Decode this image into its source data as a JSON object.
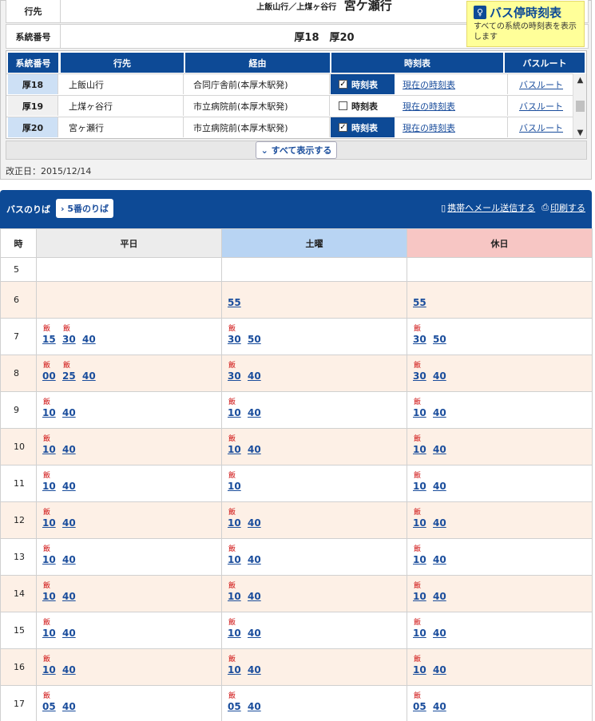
{
  "info": {
    "dest_label": "行先",
    "dest_small": "上飯山行／上煤ヶ谷行",
    "dest_big": "宮ケ瀬行",
    "num_label": "系統番号",
    "num_value": "厚18　厚20"
  },
  "stop_timetable": {
    "icon": "bus-stop-icon",
    "title": "バス停時刻表",
    "desc": "すべての系統の時刻表を表示します"
  },
  "route_table": {
    "headers": [
      "系統番号",
      "行先",
      "経由",
      "時刻表",
      "バスルート"
    ],
    "rows": [
      {
        "code": "厚18",
        "dest": "上飯山行",
        "via": "合同庁舎前(本厚木駅発)",
        "chk_label": "時刻表",
        "checked": "✓",
        "current": "現在の時刻表",
        "route": "バスルート"
      },
      {
        "code": "厚19",
        "dest": "上煤ヶ谷行",
        "via": "市立病院前(本厚木駅発)",
        "chk_label": "時刻表",
        "checked": "",
        "current": "現在の時刻表",
        "route": "バスルート"
      },
      {
        "code": "厚20",
        "dest": "宮ヶ瀬行",
        "via": "市立病院前(本厚木駅発)",
        "chk_label": "時刻表",
        "checked": "✓",
        "current": "現在の時刻表",
        "route": "バスルート"
      }
    ],
    "scroll_up": "▲",
    "scroll_down": "▼"
  },
  "show_all": "⌄ すべて表示する",
  "revised": "改正日：2015/12/14",
  "timetable": {
    "label": "バスのりば",
    "platform": "› 5番のりば",
    "mail_link": "携帯へメール送信する",
    "print_link": "印刷する",
    "col_hour": "時",
    "col_weekday": "平日",
    "col_saturday": "土曜",
    "col_holiday": "休日",
    "rows": [
      {
        "hour": "5",
        "weekday": [],
        "saturday": [],
        "holiday": []
      },
      {
        "hour": "6",
        "weekday": [],
        "saturday": [
          {
            "via": "",
            "min": "55"
          }
        ],
        "holiday": [
          {
            "via": "",
            "min": "55"
          }
        ]
      },
      {
        "hour": "7",
        "weekday": [
          {
            "via": "飯",
            "min": "15"
          },
          {
            "via": "飯",
            "min": "30"
          },
          {
            "via": "",
            "min": "40"
          }
        ],
        "saturday": [
          {
            "via": "飯",
            "min": "30"
          },
          {
            "via": "",
            "min": "50"
          }
        ],
        "holiday": [
          {
            "via": "飯",
            "min": "30"
          },
          {
            "via": "",
            "min": "50"
          }
        ]
      },
      {
        "hour": "8",
        "weekday": [
          {
            "via": "飯",
            "min": "00"
          },
          {
            "via": "飯",
            "min": "25"
          },
          {
            "via": "",
            "min": "40"
          }
        ],
        "saturday": [
          {
            "via": "飯",
            "min": "30"
          },
          {
            "via": "",
            "min": "40"
          }
        ],
        "holiday": [
          {
            "via": "飯",
            "min": "30"
          },
          {
            "via": "",
            "min": "40"
          }
        ]
      },
      {
        "hour": "9",
        "weekday": [
          {
            "via": "飯",
            "min": "10"
          },
          {
            "via": "",
            "min": "40"
          }
        ],
        "saturday": [
          {
            "via": "飯",
            "min": "10"
          },
          {
            "via": "",
            "min": "40"
          }
        ],
        "holiday": [
          {
            "via": "飯",
            "min": "10"
          },
          {
            "via": "",
            "min": "40"
          }
        ]
      },
      {
        "hour": "10",
        "weekday": [
          {
            "via": "飯",
            "min": "10"
          },
          {
            "via": "",
            "min": "40"
          }
        ],
        "saturday": [
          {
            "via": "飯",
            "min": "10"
          },
          {
            "via": "",
            "min": "40"
          }
        ],
        "holiday": [
          {
            "via": "飯",
            "min": "10"
          },
          {
            "via": "",
            "min": "40"
          }
        ]
      },
      {
        "hour": "11",
        "weekday": [
          {
            "via": "飯",
            "min": "10"
          },
          {
            "via": "",
            "min": "40"
          }
        ],
        "saturday": [
          {
            "via": "飯",
            "min": "10"
          }
        ],
        "holiday": [
          {
            "via": "飯",
            "min": "10"
          },
          {
            "via": "",
            "min": "40"
          }
        ]
      },
      {
        "hour": "12",
        "weekday": [
          {
            "via": "飯",
            "min": "10"
          },
          {
            "via": "",
            "min": "40"
          }
        ],
        "saturday": [
          {
            "via": "飯",
            "min": "10"
          },
          {
            "via": "",
            "min": "40"
          }
        ],
        "holiday": [
          {
            "via": "飯",
            "min": "10"
          },
          {
            "via": "",
            "min": "40"
          }
        ]
      },
      {
        "hour": "13",
        "weekday": [
          {
            "via": "飯",
            "min": "10"
          },
          {
            "via": "",
            "min": "40"
          }
        ],
        "saturday": [
          {
            "via": "飯",
            "min": "10"
          },
          {
            "via": "",
            "min": "40"
          }
        ],
        "holiday": [
          {
            "via": "飯",
            "min": "10"
          },
          {
            "via": "",
            "min": "40"
          }
        ]
      },
      {
        "hour": "14",
        "weekday": [
          {
            "via": "飯",
            "min": "10"
          },
          {
            "via": "",
            "min": "40"
          }
        ],
        "saturday": [
          {
            "via": "飯",
            "min": "10"
          },
          {
            "via": "",
            "min": "40"
          }
        ],
        "holiday": [
          {
            "via": "飯",
            "min": "10"
          },
          {
            "via": "",
            "min": "40"
          }
        ]
      },
      {
        "hour": "15",
        "weekday": [
          {
            "via": "飯",
            "min": "10"
          },
          {
            "via": "",
            "min": "40"
          }
        ],
        "saturday": [
          {
            "via": "飯",
            "min": "10"
          },
          {
            "via": "",
            "min": "40"
          }
        ],
        "holiday": [
          {
            "via": "飯",
            "min": "10"
          },
          {
            "via": "",
            "min": "40"
          }
        ]
      },
      {
        "hour": "16",
        "weekday": [
          {
            "via": "飯",
            "min": "10"
          },
          {
            "via": "",
            "min": "40"
          }
        ],
        "saturday": [
          {
            "via": "飯",
            "min": "10"
          },
          {
            "via": "",
            "min": "40"
          }
        ],
        "holiday": [
          {
            "via": "飯",
            "min": "10"
          },
          {
            "via": "",
            "min": "40"
          }
        ]
      },
      {
        "hour": "17",
        "weekday": [
          {
            "via": "飯",
            "min": "05"
          },
          {
            "via": "",
            "min": "40"
          }
        ],
        "saturday": [
          {
            "via": "飯",
            "min": "05"
          },
          {
            "via": "",
            "min": "40"
          }
        ],
        "holiday": [
          {
            "via": "飯",
            "min": "05"
          },
          {
            "via": "",
            "min": "40"
          }
        ]
      }
    ]
  }
}
